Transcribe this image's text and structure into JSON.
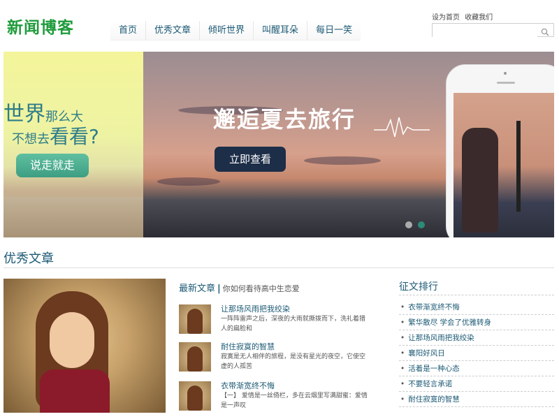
{
  "header": {
    "logo": "新闻博客",
    "nav": [
      "首页",
      "优秀文章",
      "倾听世界",
      "叫醒耳朵",
      "每日一笑"
    ],
    "toplinks": [
      "设为首页",
      "收藏我们"
    ],
    "search": {
      "placeholder": "",
      "value": ""
    }
  },
  "banner": {
    "left": {
      "line1_big": "世界",
      "line1_small": "那么大",
      "line2_small": "不想去",
      "line2_big": "看看?",
      "button": "说走就走"
    },
    "right": {
      "headline": "邂逅夏去旅行",
      "button": "立即查看"
    },
    "slides": 2,
    "active_slide": 2
  },
  "section": {
    "title": "优秀文章"
  },
  "latest": {
    "heading": "最新文章",
    "subheading": "你如何看待高中生恋爱",
    "articles": [
      {
        "title": "让那场风雨把我绞染",
        "desc": "一阵阵雷声之后，深夜的大雨就撕拨而下，洗礼着猎人的扁脸和"
      },
      {
        "title": "耐住寂寞的智慧",
        "desc": "寂寞是无人相伴的旅程，是没有星光的夜空，它使空虚的人孤苦"
      },
      {
        "title": "衣带渐宽终不悔",
        "desc": "【一】 爱情是一丝倚栏，多在云烟里写满甜蜜：爱情是一声叹"
      }
    ]
  },
  "ranking": {
    "heading": "征文排行",
    "items": [
      "衣带渐宽终不悔",
      "繁华散尽 学会了优雅转身",
      "让那场风雨把我绞染",
      "襄阳好风日",
      "活着是一种心态",
      "不要轻言承诺",
      "耐住寂寞的智慧"
    ]
  },
  "colors": {
    "brand": "#1f9b3c",
    "link": "#1c5a75",
    "cta": "#1d2e48",
    "accent": "#2b8b78"
  },
  "icons": [
    "search-icon"
  ]
}
